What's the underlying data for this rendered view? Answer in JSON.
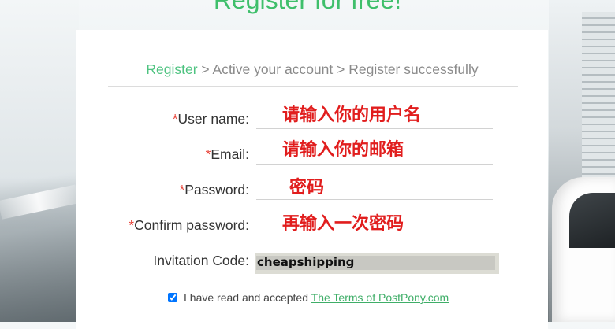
{
  "page": {
    "title": "Register for free!"
  },
  "steps": {
    "step1": "Register",
    "sep1": " > ",
    "step2": "Active your account",
    "sep2": " > ",
    "step3": "Register successfully"
  },
  "form": {
    "required_mark": "*",
    "username_label": "User name:",
    "email_label": "Email:",
    "password_label": "Password:",
    "confirm_label": "Confirm password:",
    "invitation_label": "Invitation Code:",
    "invitation_value": "cheapshipping"
  },
  "annotations": {
    "username_note": "请输入你的用户名",
    "email_note": "请输入你的邮箱",
    "password_note": "密码",
    "confirm_note": "再输入一次密码"
  },
  "agreement": {
    "checked": true,
    "text": "I have read and accepted ",
    "link": "The Terms of PostPony.com"
  },
  "colors": {
    "accent": "#4ec380",
    "required": "#e8443a",
    "annotation": "#e11d1d"
  }
}
